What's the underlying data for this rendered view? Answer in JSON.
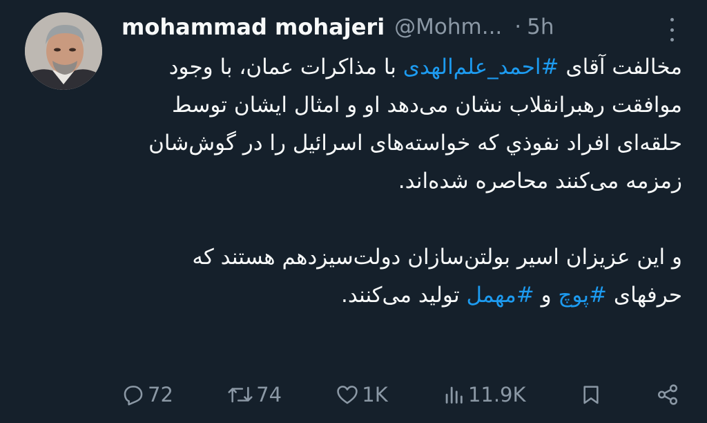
{
  "author": {
    "name": "mohammad mohajeri",
    "handle": "@Mohm...",
    "separator": "·",
    "time": "5h"
  },
  "tweet": {
    "p1_before": "مخالفت آقای ",
    "hashtag1": "#احمد_علم‌الهدی",
    "p1_after": " با مذاکرات عمان، با وجود موافقت رهبرانقلاب نشان می‌دهد او و امثال ایشان توسط حلقه‌ای افراد نفوذي که خواسته‌های اسرائیل را در گوش‌شان زمزمه می‌کنند محاصره شده‌اند.",
    "p2_before": "و این عزیزان اسیر بولتن‌سازان دولت‌سیزدهم هستند که حرفهای ",
    "hashtag2": "#پوچ",
    "p2_mid": " و ",
    "hashtag3": "#مهمل",
    "p2_after": " تولید می‌کنند."
  },
  "actions": {
    "replies": "72",
    "retweets": "74",
    "likes": "1K",
    "views": "11.9K"
  },
  "icons": [
    "reply-icon",
    "retweet-icon",
    "like-icon",
    "views-icon",
    "bookmark-icon",
    "share-icon",
    "more-icon"
  ],
  "colors": {
    "background": "#15202b",
    "text": "#f7f9f9",
    "secondary": "#8b98a5",
    "link": "#1d9bf0"
  }
}
